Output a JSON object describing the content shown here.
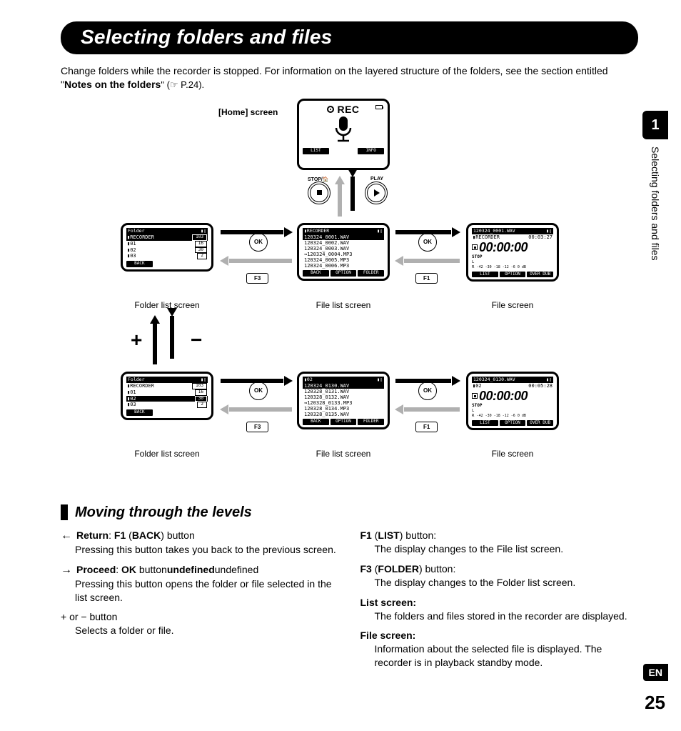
{
  "title": "Selecting folders and files",
  "intro_a": "Change folders while the recorder is stopped. For information on the layered structure of the folders, see the section entitled \"",
  "intro_b": "Notes on the folders",
  "intro_c": "\" (☞ P.24).",
  "side": {
    "num": "1",
    "text": "Selecting folders and files"
  },
  "lang": "EN",
  "page": "25",
  "diagram": {
    "home_label": "[Home] screen",
    "rec_label": "REC",
    "stop_label": "STOP/🏠",
    "play_label": "PLAY",
    "ok": "OK",
    "f1": "F1",
    "f3": "F3",
    "captions": {
      "folder": "Folder list screen",
      "filelist": "File list screen",
      "file": "File screen"
    },
    "plus": "+",
    "minus": "−",
    "screens": {
      "folder1": {
        "hdr": "Folder",
        "rows": [
          [
            "▮RECORDER",
            "103"
          ],
          [
            "▮01",
            "16"
          ],
          [
            "▮02",
            "30"
          ],
          [
            "▮03",
            "2"
          ]
        ],
        "sel": 0,
        "ftr": [
          "BACK",
          "",
          ""
        ]
      },
      "folder2": {
        "hdr": "Folder",
        "rows": [
          [
            "▮RECORDER",
            "103"
          ],
          [
            "▮01",
            "16"
          ],
          [
            "▮02",
            "30"
          ],
          [
            "▮03",
            "2"
          ]
        ],
        "sel": 2,
        "ftr": [
          "BACK",
          "",
          ""
        ]
      },
      "filelist1": {
        "hdr": "▮RECORDER",
        "rows": [
          "120324_0001.WAV",
          "120324_0002.WAV",
          "120324_0003.WAV",
          "⊸120324_0004.MP3",
          "120324_0005.MP3",
          "120324_0006.MP3"
        ],
        "sel": 0,
        "ftr": [
          "BACK",
          "OPTION",
          "FOLDER"
        ]
      },
      "filelist2": {
        "hdr": "▮02",
        "rows": [
          "120324_0130.WAV",
          "120328_0131.WAV",
          "120328_0132.WAV",
          "⊸120328_0133.MP3",
          "120328_0134.MP3",
          "120328_0135.WAV"
        ],
        "sel": 0,
        "ftr": [
          "BACK",
          "OPTION",
          "FOLDER"
        ]
      },
      "file1": {
        "hdr": "120324_0001.WAV",
        "folder": "▮RECORDER",
        "dur": "00:03:27",
        "time": "00:00:00",
        "stop": "STOP",
        "meter_l": "L",
        "meter_r": "R",
        "scale": "-42  -30  -18  -12  -6  0 dB",
        "ftr": [
          "LIST",
          "OPTION",
          "OVER DUB"
        ]
      },
      "file2": {
        "hdr": "120324_0130.WAV",
        "folder": "▮02",
        "dur": "00:05:28",
        "time": "00:00:00",
        "stop": "STOP",
        "meter_l": "L",
        "meter_r": "R",
        "scale": "-42  -30  -18  -12  -6  0 dB",
        "ftr": [
          "LIST",
          "OPTION",
          "OVER DUB"
        ]
      }
    }
  },
  "section_title": "Moving through the levels",
  "left_items": [
    {
      "arrow": "←",
      "head_parts": [
        "Return",
        ": ",
        "F1",
        " (",
        "BACK",
        ") button"
      ],
      "body": "Pressing this button takes you back to the previous screen."
    },
    {
      "arrow": "→",
      "head_parts": [
        "Proceed",
        ": ",
        "OK",
        " button"
      ],
      "body": "Pressing this button opens the folder or file selected in the list screen."
    },
    {
      "arrow": "",
      "head_plain": "+ or − button",
      "body": "Selects a folder or file."
    }
  ],
  "right_items": [
    {
      "head_parts": [
        "F1",
        " (",
        "LIST",
        ") button:"
      ],
      "body": "The display changes to the File list screen."
    },
    {
      "head_parts": [
        "F3",
        " (",
        "FOLDER",
        ") button:"
      ],
      "body": "The display changes to the Folder list screen."
    },
    {
      "head_bold": "List screen:",
      "body": "The folders and files stored in the recorder are displayed."
    },
    {
      "head_bold": "File screen:",
      "body": "Information about the selected file is displayed. The recorder is in playback standby mode."
    }
  ]
}
